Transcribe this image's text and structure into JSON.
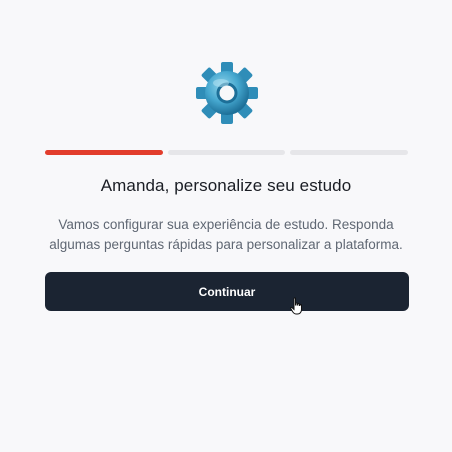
{
  "header": {
    "icon": "gear-icon"
  },
  "progress": {
    "steps": 3,
    "current": 1,
    "accent_color": "#e23d2c",
    "inactive_color": "#e6e6e9"
  },
  "main": {
    "title": "Amanda, personalize seu estudo",
    "description": "Vamos configurar sua experiência de estudo. Responda algumas perguntas rápidas para personalizar a plataforma."
  },
  "actions": {
    "continue_label": "Continuar",
    "button_color": "#1b2432"
  },
  "cursor": {
    "icon": "hand-pointer-icon"
  }
}
